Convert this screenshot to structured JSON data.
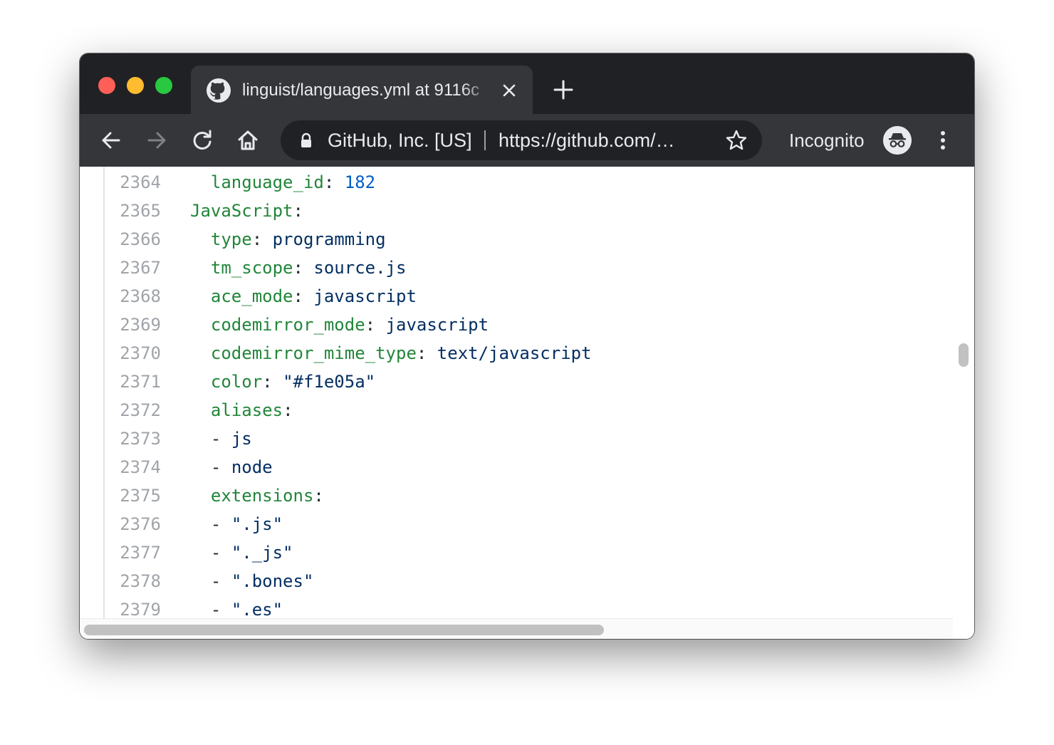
{
  "browser": {
    "tab": {
      "title": "linguist/languages.yml at 9116c",
      "favicon": "github-icon"
    },
    "omnibox": {
      "site_identity": "GitHub, Inc. [US]",
      "url": "https://github.com/…"
    },
    "incognito_label": "Incognito",
    "icons": [
      "back-icon",
      "forward-icon",
      "reload-icon",
      "home-icon",
      "lock-icon",
      "star-icon",
      "incognito-icon",
      "menu-icon",
      "close-icon",
      "plus-icon"
    ]
  },
  "code": {
    "lines": [
      {
        "number": "2364",
        "indent": "  ",
        "key": "language_id",
        "value": "182",
        "value_type": "number"
      },
      {
        "number": "2365",
        "indent": "",
        "key": "JavaScript",
        "value": "",
        "value_type": "none"
      },
      {
        "number": "2366",
        "indent": "  ",
        "key": "type",
        "value": "programming",
        "value_type": "string"
      },
      {
        "number": "2367",
        "indent": "  ",
        "key": "tm_scope",
        "value": "source.js",
        "value_type": "string"
      },
      {
        "number": "2368",
        "indent": "  ",
        "key": "ace_mode",
        "value": "javascript",
        "value_type": "string"
      },
      {
        "number": "2369",
        "indent": "  ",
        "key": "codemirror_mode",
        "value": "javascript",
        "value_type": "string"
      },
      {
        "number": "2370",
        "indent": "  ",
        "key": "codemirror_mime_type",
        "value": "text/javascript",
        "value_type": "string"
      },
      {
        "number": "2371",
        "indent": "  ",
        "key": "color",
        "value": "\"#f1e05a\"",
        "value_type": "string"
      },
      {
        "number": "2372",
        "indent": "  ",
        "key": "aliases",
        "value": "",
        "value_type": "none"
      },
      {
        "number": "2373",
        "indent": "  ",
        "item": "js"
      },
      {
        "number": "2374",
        "indent": "  ",
        "item": "node"
      },
      {
        "number": "2375",
        "indent": "  ",
        "key": "extensions",
        "value": "",
        "value_type": "none"
      },
      {
        "number": "2376",
        "indent": "  ",
        "item": "\".js\""
      },
      {
        "number": "2377",
        "indent": "  ",
        "item": "\"._js\""
      },
      {
        "number": "2378",
        "indent": "  ",
        "item": "\".bones\""
      },
      {
        "number": "2379",
        "indent": "  ",
        "item": "\".es\""
      }
    ]
  },
  "colors": {
    "chrome_dark": "#202124",
    "chrome_tab": "#35363a",
    "yaml_key": "#22863a",
    "yaml_string": "#032f62",
    "yaml_number": "#005cc5",
    "line_number": "#a0a4a9"
  }
}
